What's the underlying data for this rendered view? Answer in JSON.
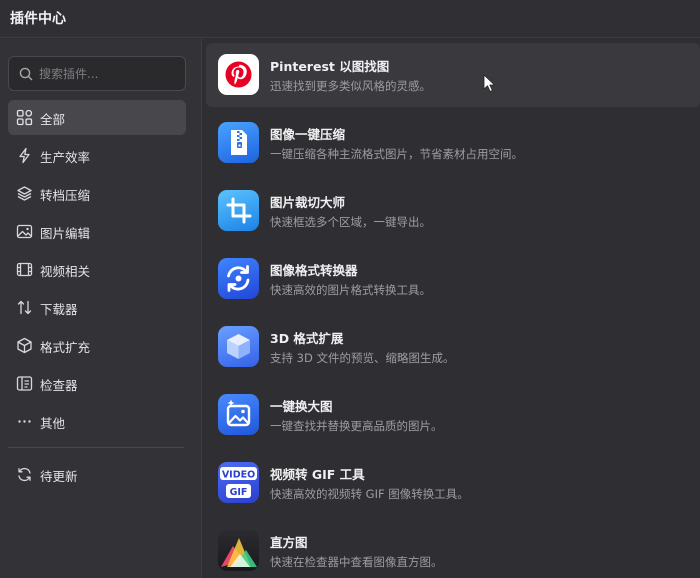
{
  "window": {
    "title": "插件中心"
  },
  "search": {
    "placeholder": "搜索插件..."
  },
  "sidebar": {
    "items": [
      {
        "label": "全部",
        "icon": "grid-icon"
      },
      {
        "label": "生产效率",
        "icon": "lightning-icon"
      },
      {
        "label": "转档压缩",
        "icon": "layers-icon"
      },
      {
        "label": "图片编辑",
        "icon": "image-icon"
      },
      {
        "label": "视频相关",
        "icon": "film-icon"
      },
      {
        "label": "下载器",
        "icon": "arrows-updown-icon"
      },
      {
        "label": "格式扩充",
        "icon": "cube-icon"
      },
      {
        "label": "检查器",
        "icon": "inspector-icon"
      },
      {
        "label": "其他",
        "icon": "more-icon"
      }
    ],
    "footer_items": [
      {
        "label": "待更新",
        "icon": "refresh-icon"
      }
    ]
  },
  "plugins": [
    {
      "name": "Pinterest 以图找图",
      "desc": "迅速找到更多类似风格的灵感。",
      "icon": "pinterest-icon"
    },
    {
      "name": "图像一键压缩",
      "desc": "一键压缩各种主流格式图片，节省素材占用空间。",
      "icon": "zip-icon"
    },
    {
      "name": "图片裁切大师",
      "desc": "快速框选多个区域，一键导出。",
      "icon": "crop-icon"
    },
    {
      "name": "图像格式转换器",
      "desc": "快速高效的图片格式转换工具。",
      "icon": "convert-icon"
    },
    {
      "name": "3D 格式扩展",
      "desc": "支持 3D 文件的预览、缩略图生成。",
      "icon": "cube3d-icon"
    },
    {
      "name": "一键换大图",
      "desc": "一键查找并替换更高品质的图片。",
      "icon": "upscale-image-icon"
    },
    {
      "name": "视频转 GIF 工具",
      "desc": "快速高效的视频转 GIF 图像转换工具。",
      "icon": "video-gif-icon",
      "badge_top": "VIDEO",
      "badge_bottom": "GIF"
    },
    {
      "name": "直方图",
      "desc": "快速在检查器中查看图像直方图。",
      "icon": "histogram-icon"
    }
  ],
  "colors": {
    "background": "#2f2f33",
    "sidebar": "#333337",
    "active_item": "#47474c",
    "pinterest_red": "#e60023",
    "accent_blue": "#2f6fe0"
  }
}
